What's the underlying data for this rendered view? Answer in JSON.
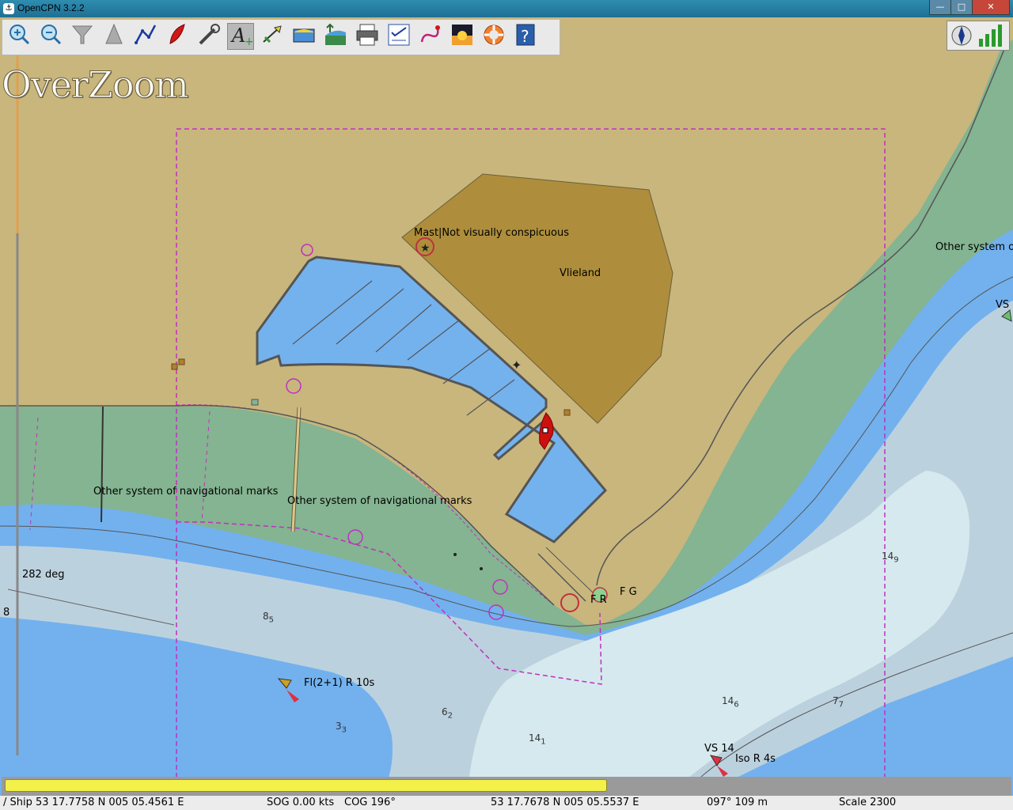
{
  "window": {
    "title": "OpenCPN 3.2.2",
    "minimize_glyph": "—",
    "maximize_glyph": "□",
    "close_glyph": "✕"
  },
  "toolbar": {
    "buttons": [
      {
        "name": "zoom-in-button",
        "icon": "zoom-in-icon"
      },
      {
        "name": "zoom-out-button",
        "icon": "zoom-out-icon"
      },
      {
        "name": "scale-in-button",
        "icon": "funnel-icon"
      },
      {
        "name": "scale-out-button",
        "icon": "cone-icon"
      },
      {
        "name": "create-route-button",
        "icon": "route-icon"
      },
      {
        "name": "auto-follow-button",
        "icon": "boat-icon"
      },
      {
        "name": "settings-button",
        "icon": "wrench-icon"
      },
      {
        "name": "text-button",
        "icon": "text-icon",
        "active": true
      },
      {
        "name": "current-button",
        "icon": "current-icon"
      },
      {
        "name": "tide-button",
        "icon": "tide-icon"
      },
      {
        "name": "chart-quilt-button",
        "icon": "layers-icon"
      },
      {
        "name": "print-button",
        "icon": "printer-icon"
      },
      {
        "name": "route-manager-button",
        "icon": "checklist-icon"
      },
      {
        "name": "track-button",
        "icon": "track-icon"
      },
      {
        "name": "color-scheme-button",
        "icon": "sunset-icon"
      },
      {
        "name": "mob-button",
        "icon": "lifebuoy-icon"
      },
      {
        "name": "help-button",
        "icon": "help-icon"
      }
    ]
  },
  "chart": {
    "overzoom": "OverZoom",
    "labels": {
      "mast": "Mast|Not visually conspicuous",
      "vlieland": "Vlieland",
      "other_marks_left": "Other system of navigational marks",
      "other_marks_center": "Other system of navigational marks",
      "other_marks_right": "Other system o",
      "vs_right": "VS",
      "fg": "F G",
      "fr": "F R",
      "fl_light": "Fl(2+1) R 10s",
      "vs14": "VS 14",
      "iso": "Iso R 4s",
      "heading": "282 deg",
      "edge_eight": "8"
    },
    "soundings": [
      {
        "main": "8",
        "sub": "5"
      },
      {
        "main": "3",
        "sub": "3"
      },
      {
        "main": "6",
        "sub": "2"
      },
      {
        "main": "14",
        "sub": "1"
      },
      {
        "main": "14",
        "sub": "6"
      },
      {
        "main": "7",
        "sub": "7"
      },
      {
        "main": "14",
        "sub": "9"
      }
    ]
  },
  "progress": {
    "fraction": 0.595
  },
  "status": {
    "ship": "/ Ship 53 17.7758 N   005 05.4561 E",
    "sog": "SOG 0.00 kts",
    "cog": "COG 196°",
    "cursor_pos": "53 17.7678 N    005 05.5537 E",
    "bearing": "097°  109 m",
    "scale": "Scale 2300"
  },
  "colors": {
    "land": "#c8b67d",
    "built_area": "#ae8e3c",
    "intertidal": "#84b491",
    "shallow": "#72b1ee",
    "medium": "#bcd1de",
    "deep": "#d6e9ee",
    "boundary": "#c030c0"
  }
}
